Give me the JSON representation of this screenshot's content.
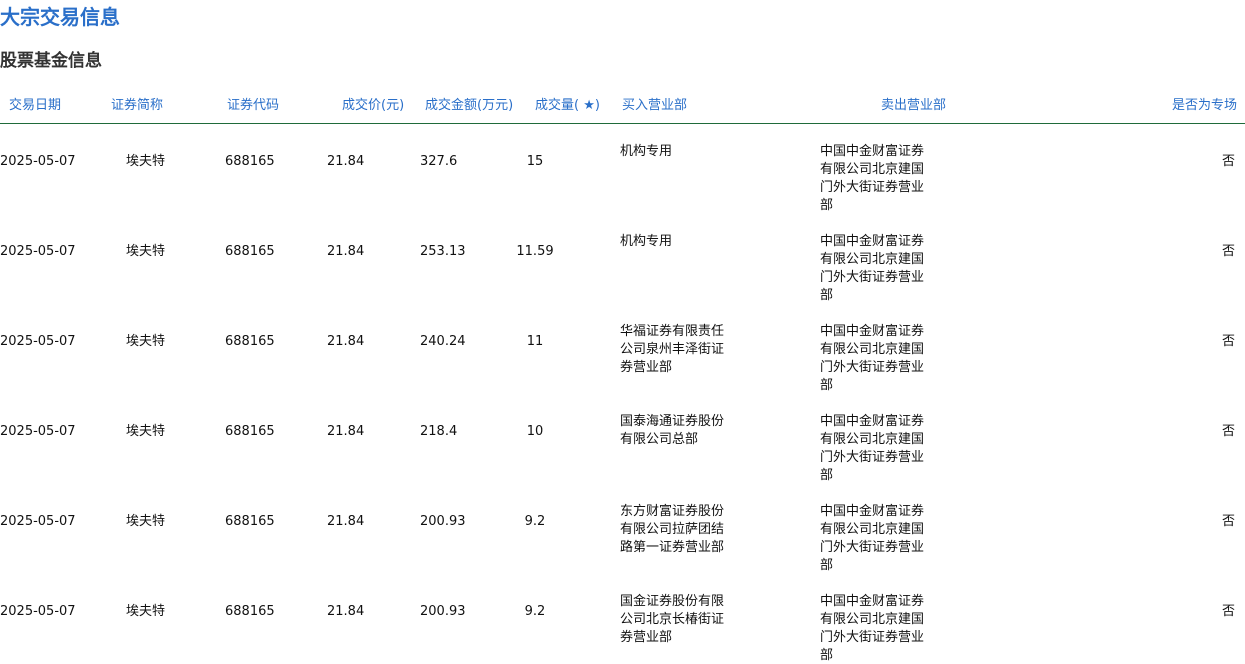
{
  "title": "大宗交易信息",
  "subtitle": "股票基金信息",
  "columns": {
    "date": "交易日期",
    "name": "证券简称",
    "code": "证券代码",
    "price": "成交价(元)",
    "amount": "成交金额(万元)",
    "volume": "成交量(  ★)",
    "buyer": "买入营业部",
    "seller": "卖出营业部",
    "special": "是否为专场"
  },
  "rows": [
    {
      "date": "2025-05-07",
      "name": "埃夫特",
      "code": "688165",
      "price": "21.84",
      "amount": "327.6",
      "volume": "15",
      "buyer": "机构专用",
      "seller": "中国中金财富证券有限公司北京建国门外大街证券营业部",
      "special": "否"
    },
    {
      "date": "2025-05-07",
      "name": "埃夫特",
      "code": "688165",
      "price": "21.84",
      "amount": "253.13",
      "volume": "11.59",
      "buyer": "机构专用",
      "seller": "中国中金财富证券有限公司北京建国门外大街证券营业部",
      "special": "否"
    },
    {
      "date": "2025-05-07",
      "name": "埃夫特",
      "code": "688165",
      "price": "21.84",
      "amount": "240.24",
      "volume": "11",
      "buyer": "华福证券有限责任公司泉州丰泽街证券营业部",
      "seller": "中国中金财富证券有限公司北京建国门外大街证券营业部",
      "special": "否"
    },
    {
      "date": "2025-05-07",
      "name": "埃夫特",
      "code": "688165",
      "price": "21.84",
      "amount": "218.4",
      "volume": "10",
      "buyer": "国泰海通证券股份有限公司总部",
      "seller": "中国中金财富证券有限公司北京建国门外大街证券营业部",
      "special": "否"
    },
    {
      "date": "2025-05-07",
      "name": "埃夫特",
      "code": "688165",
      "price": "21.84",
      "amount": "200.93",
      "volume": "9.2",
      "buyer": "东方财富证券股份有限公司拉萨团结路第一证券营业部",
      "seller": "中国中金财富证券有限公司北京建国门外大街证券营业部",
      "special": "否"
    },
    {
      "date": "2025-05-07",
      "name": "埃夫特",
      "code": "688165",
      "price": "21.84",
      "amount": "200.93",
      "volume": "9.2",
      "buyer": "国金证券股份有限公司北京长椿街证券营业部",
      "seller": "中国中金财富证券有限公司北京建国门外大街证券营业部",
      "special": "否"
    }
  ]
}
